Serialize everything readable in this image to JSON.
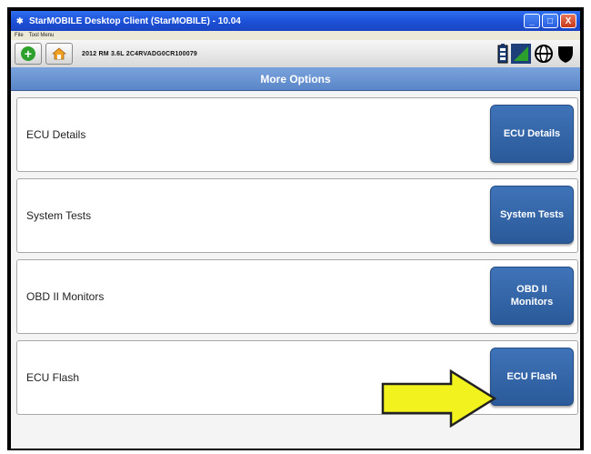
{
  "window": {
    "title": "StarMOBILE Desktop Client (StarMOBILE) - 10.04",
    "controls": {
      "minimize": "_",
      "maximize": "□",
      "close": "X"
    }
  },
  "menubar": {
    "items": [
      "File",
      "Tool Menu"
    ]
  },
  "toolbar": {
    "vehicle_info": "2012 RM 3.6L 2C4RVADG0CR100079",
    "status_icons": [
      "battery-icon",
      "signal-icon",
      "network-icon",
      "shield-icon"
    ]
  },
  "content": {
    "header": "More Options",
    "options": [
      {
        "label": "ECU Details",
        "button": "ECU Details"
      },
      {
        "label": "System Tests",
        "button": "System Tests"
      },
      {
        "label": "OBD II Monitors",
        "button": "OBD II\nMonitors"
      },
      {
        "label": "ECU Flash",
        "button": "ECU Flash"
      }
    ]
  },
  "colors": {
    "titlebar": "#1c4fd6",
    "header": "#6a93d0",
    "button": "#3565a8",
    "arrow": "#f2f21e"
  }
}
